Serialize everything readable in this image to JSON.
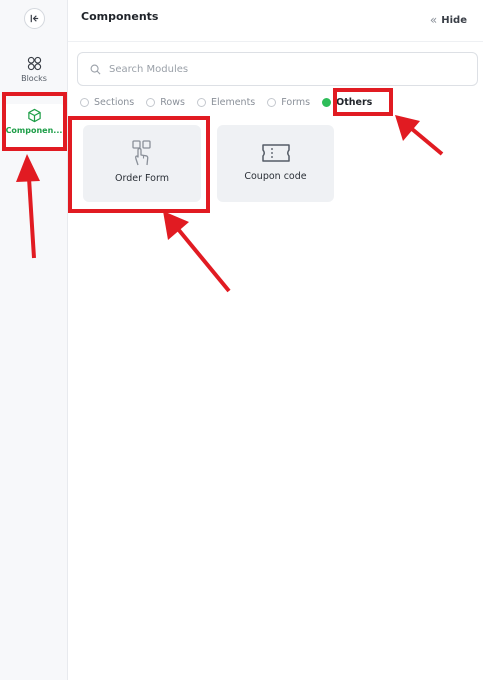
{
  "rail": {
    "collapse_icon": "collapse-left-icon",
    "items": [
      {
        "label": "Blocks",
        "icon": "blocks-grid-icon",
        "active": false
      },
      {
        "label": "Componen...",
        "icon": "cube-icon",
        "active": true
      }
    ]
  },
  "panel": {
    "title": "Components",
    "hide_label": "Hide",
    "search": {
      "placeholder": "Search Modules",
      "value": ""
    },
    "filters": [
      {
        "label": "Sections",
        "selected": false
      },
      {
        "label": "Rows",
        "selected": false
      },
      {
        "label": "Elements",
        "selected": false
      },
      {
        "label": "Forms",
        "selected": false
      },
      {
        "label": "Others",
        "selected": true
      }
    ],
    "cards": [
      {
        "label": "Order Form",
        "icon": "hand-pointer-grid-icon"
      },
      {
        "label": "Coupon code",
        "icon": "ticket-icon"
      }
    ]
  },
  "colors": {
    "accent_green": "#2ebd59",
    "annotation_red": "#e11b22",
    "rail_bg": "#f7f8fa",
    "card_bg": "#eff1f4"
  }
}
